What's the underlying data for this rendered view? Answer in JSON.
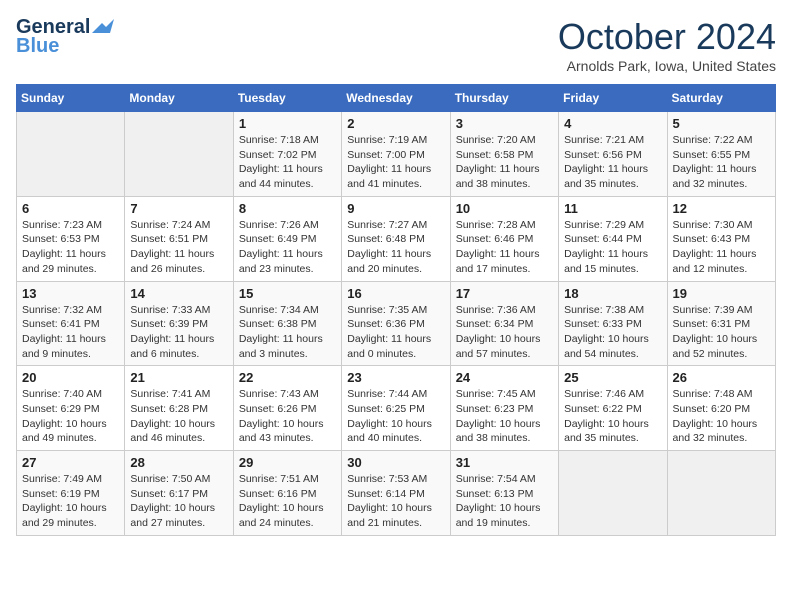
{
  "logo": {
    "line1": "General",
    "line2": "Blue"
  },
  "title": "October 2024",
  "subtitle": "Arnolds Park, Iowa, United States",
  "weekdays": [
    "Sunday",
    "Monday",
    "Tuesday",
    "Wednesday",
    "Thursday",
    "Friday",
    "Saturday"
  ],
  "weeks": [
    [
      null,
      null,
      {
        "day": "1",
        "sunrise": "Sunrise: 7:18 AM",
        "sunset": "Sunset: 7:02 PM",
        "daylight": "Daylight: 11 hours and 44 minutes."
      },
      {
        "day": "2",
        "sunrise": "Sunrise: 7:19 AM",
        "sunset": "Sunset: 7:00 PM",
        "daylight": "Daylight: 11 hours and 41 minutes."
      },
      {
        "day": "3",
        "sunrise": "Sunrise: 7:20 AM",
        "sunset": "Sunset: 6:58 PM",
        "daylight": "Daylight: 11 hours and 38 minutes."
      },
      {
        "day": "4",
        "sunrise": "Sunrise: 7:21 AM",
        "sunset": "Sunset: 6:56 PM",
        "daylight": "Daylight: 11 hours and 35 minutes."
      },
      {
        "day": "5",
        "sunrise": "Sunrise: 7:22 AM",
        "sunset": "Sunset: 6:55 PM",
        "daylight": "Daylight: 11 hours and 32 minutes."
      }
    ],
    [
      {
        "day": "6",
        "sunrise": "Sunrise: 7:23 AM",
        "sunset": "Sunset: 6:53 PM",
        "daylight": "Daylight: 11 hours and 29 minutes."
      },
      {
        "day": "7",
        "sunrise": "Sunrise: 7:24 AM",
        "sunset": "Sunset: 6:51 PM",
        "daylight": "Daylight: 11 hours and 26 minutes."
      },
      {
        "day": "8",
        "sunrise": "Sunrise: 7:26 AM",
        "sunset": "Sunset: 6:49 PM",
        "daylight": "Daylight: 11 hours and 23 minutes."
      },
      {
        "day": "9",
        "sunrise": "Sunrise: 7:27 AM",
        "sunset": "Sunset: 6:48 PM",
        "daylight": "Daylight: 11 hours and 20 minutes."
      },
      {
        "day": "10",
        "sunrise": "Sunrise: 7:28 AM",
        "sunset": "Sunset: 6:46 PM",
        "daylight": "Daylight: 11 hours and 17 minutes."
      },
      {
        "day": "11",
        "sunrise": "Sunrise: 7:29 AM",
        "sunset": "Sunset: 6:44 PM",
        "daylight": "Daylight: 11 hours and 15 minutes."
      },
      {
        "day": "12",
        "sunrise": "Sunrise: 7:30 AM",
        "sunset": "Sunset: 6:43 PM",
        "daylight": "Daylight: 11 hours and 12 minutes."
      }
    ],
    [
      {
        "day": "13",
        "sunrise": "Sunrise: 7:32 AM",
        "sunset": "Sunset: 6:41 PM",
        "daylight": "Daylight: 11 hours and 9 minutes."
      },
      {
        "day": "14",
        "sunrise": "Sunrise: 7:33 AM",
        "sunset": "Sunset: 6:39 PM",
        "daylight": "Daylight: 11 hours and 6 minutes."
      },
      {
        "day": "15",
        "sunrise": "Sunrise: 7:34 AM",
        "sunset": "Sunset: 6:38 PM",
        "daylight": "Daylight: 11 hours and 3 minutes."
      },
      {
        "day": "16",
        "sunrise": "Sunrise: 7:35 AM",
        "sunset": "Sunset: 6:36 PM",
        "daylight": "Daylight: 11 hours and 0 minutes."
      },
      {
        "day": "17",
        "sunrise": "Sunrise: 7:36 AM",
        "sunset": "Sunset: 6:34 PM",
        "daylight": "Daylight: 10 hours and 57 minutes."
      },
      {
        "day": "18",
        "sunrise": "Sunrise: 7:38 AM",
        "sunset": "Sunset: 6:33 PM",
        "daylight": "Daylight: 10 hours and 54 minutes."
      },
      {
        "day": "19",
        "sunrise": "Sunrise: 7:39 AM",
        "sunset": "Sunset: 6:31 PM",
        "daylight": "Daylight: 10 hours and 52 minutes."
      }
    ],
    [
      {
        "day": "20",
        "sunrise": "Sunrise: 7:40 AM",
        "sunset": "Sunset: 6:29 PM",
        "daylight": "Daylight: 10 hours and 49 minutes."
      },
      {
        "day": "21",
        "sunrise": "Sunrise: 7:41 AM",
        "sunset": "Sunset: 6:28 PM",
        "daylight": "Daylight: 10 hours and 46 minutes."
      },
      {
        "day": "22",
        "sunrise": "Sunrise: 7:43 AM",
        "sunset": "Sunset: 6:26 PM",
        "daylight": "Daylight: 10 hours and 43 minutes."
      },
      {
        "day": "23",
        "sunrise": "Sunrise: 7:44 AM",
        "sunset": "Sunset: 6:25 PM",
        "daylight": "Daylight: 10 hours and 40 minutes."
      },
      {
        "day": "24",
        "sunrise": "Sunrise: 7:45 AM",
        "sunset": "Sunset: 6:23 PM",
        "daylight": "Daylight: 10 hours and 38 minutes."
      },
      {
        "day": "25",
        "sunrise": "Sunrise: 7:46 AM",
        "sunset": "Sunset: 6:22 PM",
        "daylight": "Daylight: 10 hours and 35 minutes."
      },
      {
        "day": "26",
        "sunrise": "Sunrise: 7:48 AM",
        "sunset": "Sunset: 6:20 PM",
        "daylight": "Daylight: 10 hours and 32 minutes."
      }
    ],
    [
      {
        "day": "27",
        "sunrise": "Sunrise: 7:49 AM",
        "sunset": "Sunset: 6:19 PM",
        "daylight": "Daylight: 10 hours and 29 minutes."
      },
      {
        "day": "28",
        "sunrise": "Sunrise: 7:50 AM",
        "sunset": "Sunset: 6:17 PM",
        "daylight": "Daylight: 10 hours and 27 minutes."
      },
      {
        "day": "29",
        "sunrise": "Sunrise: 7:51 AM",
        "sunset": "Sunset: 6:16 PM",
        "daylight": "Daylight: 10 hours and 24 minutes."
      },
      {
        "day": "30",
        "sunrise": "Sunrise: 7:53 AM",
        "sunset": "Sunset: 6:14 PM",
        "daylight": "Daylight: 10 hours and 21 minutes."
      },
      {
        "day": "31",
        "sunrise": "Sunrise: 7:54 AM",
        "sunset": "Sunset: 6:13 PM",
        "daylight": "Daylight: 10 hours and 19 minutes."
      },
      null,
      null
    ]
  ]
}
